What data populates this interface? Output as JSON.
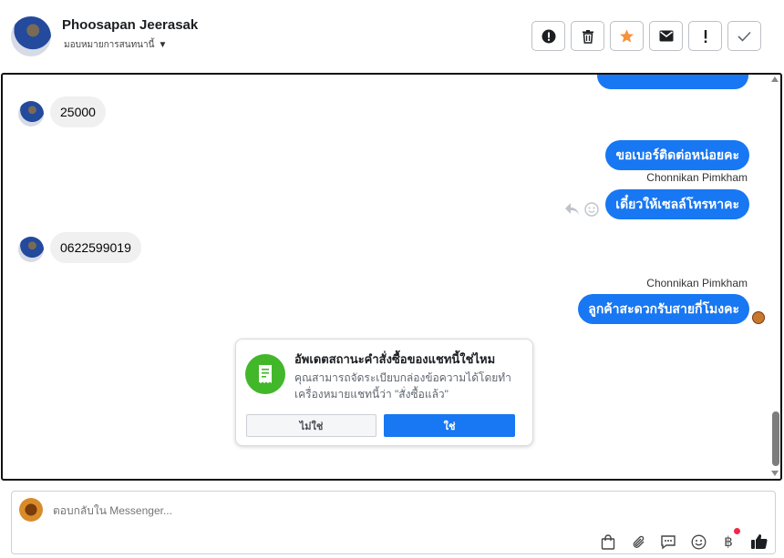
{
  "header": {
    "contact_name": "Phoosapan Jeerasak",
    "assign_label": "มอบหมายการสนทนานี้",
    "actions": [
      "mark-spam",
      "delete",
      "star",
      "mark-unread",
      "important",
      "done"
    ]
  },
  "messages": [
    {
      "direction": "in",
      "text": "25000"
    },
    {
      "direction": "out",
      "text": "ขอเบอร์ติดต่อหน่อยคะ"
    },
    {
      "direction": "out",
      "sender": "Chonnikan Pimkham",
      "text": "เดี๋ยวให้เซลล์โทรหาคะ"
    },
    {
      "direction": "in",
      "text": "0622599019"
    },
    {
      "direction": "out",
      "sender": "Chonnikan Pimkham",
      "text": "ลูกค้าสะดวกรับสายกี่โมงคะ"
    }
  ],
  "order_prompt": {
    "title": "อัพเดตสถานะคำสั่งซื้อของแชทนี้ใช่ไหม",
    "description": "คุณสามารถจัดระเบียบกล่องข้อความได้โดยทำเครื่องหมายแชทนี้ว่า \"สั่งซื้อแล้ว\"",
    "no_label": "ไม่ใช่",
    "yes_label": "ใช่"
  },
  "composer": {
    "placeholder": "ตอบกลับใน Messenger..."
  },
  "colors": {
    "accent": "#1877f2",
    "success": "#42b72a",
    "notification": "#f02849"
  },
  "icons": [
    "spam-icon",
    "trash-icon",
    "star-icon",
    "mail-icon",
    "exclamation-icon",
    "check-icon",
    "reply-icon",
    "emoji-icon",
    "bag-icon",
    "paperclip-icon",
    "chat-icon",
    "smiley-icon",
    "baht-icon",
    "like-icon",
    "receipt-icon"
  ]
}
